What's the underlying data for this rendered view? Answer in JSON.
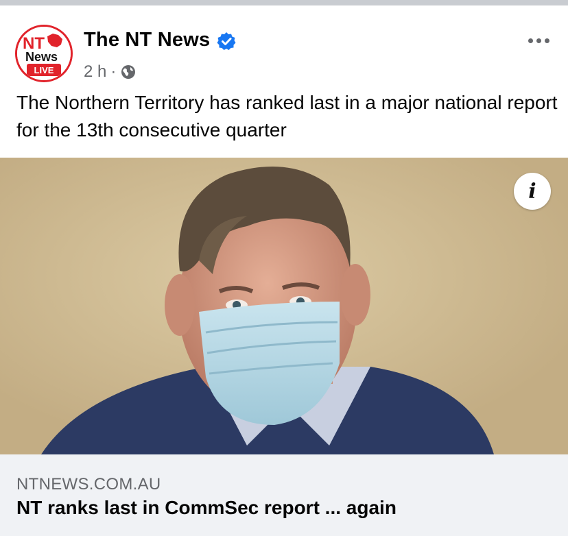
{
  "post": {
    "page_name": "The NT News",
    "verified": true,
    "time": "2 h",
    "separator": "·",
    "audience_icon": "globe-icon",
    "more_icon": "more-horizontal-icon",
    "text": "The Northern Territory has ranked last in a major national report for the 13th consecutive quarter"
  },
  "avatar": {
    "logo_text_top": "NT",
    "logo_text_middle": "News",
    "logo_badge": "LIVE",
    "brand_color": "#e1232b"
  },
  "image": {
    "info_label": "i",
    "description_icon": "news-photo"
  },
  "link": {
    "domain": "NTNEWS.COM.AU",
    "title": "NT ranks last in CommSec report ... again"
  },
  "colors": {
    "verified_blue": "#1877f2",
    "meta_gray": "#65676b",
    "footer_bg": "#f0f2f5"
  }
}
